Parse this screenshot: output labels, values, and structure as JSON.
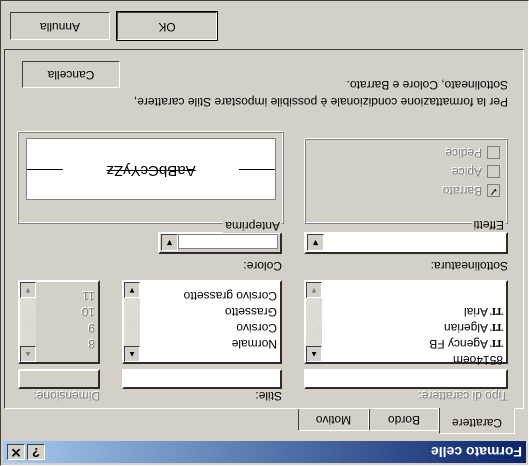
{
  "window": {
    "title": "Formato celle",
    "help_glyph": "?",
    "close_glyph": "✕"
  },
  "tabs": [
    {
      "label": "Carattere"
    },
    {
      "label": "Bordo"
    },
    {
      "label": "Motivo"
    }
  ],
  "font": {
    "font_label": "Tipo di carattere:",
    "font_value": "",
    "font_list": [
      "Agency FB",
      "Algerian",
      "Arial"
    ],
    "font_list_partial": "8514oem",
    "style_label": "Stile:",
    "style_value": "",
    "style_list": [
      "Normale",
      "Corsivo",
      "Grassetto",
      "Corsivo grassetto"
    ],
    "size_label": "Dimensione:",
    "size_value": "",
    "size_list": [
      "8",
      "9",
      "10",
      "11"
    ],
    "underline_label": "Sottolineatura:",
    "underline_value": "",
    "color_label": "Colore:",
    "effects_title": "Effetti",
    "effects": [
      {
        "label": "Barrato",
        "checked": true
      },
      {
        "label": "Apice",
        "checked": false
      },
      {
        "label": "Pedice",
        "checked": false
      }
    ],
    "preview_title": "Anteprima",
    "preview_text": "AaBbCcYyZz",
    "info_text_1": "Per la formattazione condizionale è possibile impostare Stile carattere,",
    "info_text_2": "Sottolineato, Colore e Barrato.",
    "clear_label": "Cancella"
  },
  "buttons": {
    "ok_label": "OK",
    "cancel_label": "Annulla"
  },
  "icons": {
    "font_type_icon": "TT",
    "scroll_up": "▲",
    "scroll_down": "▼",
    "dropdown": "▼"
  }
}
